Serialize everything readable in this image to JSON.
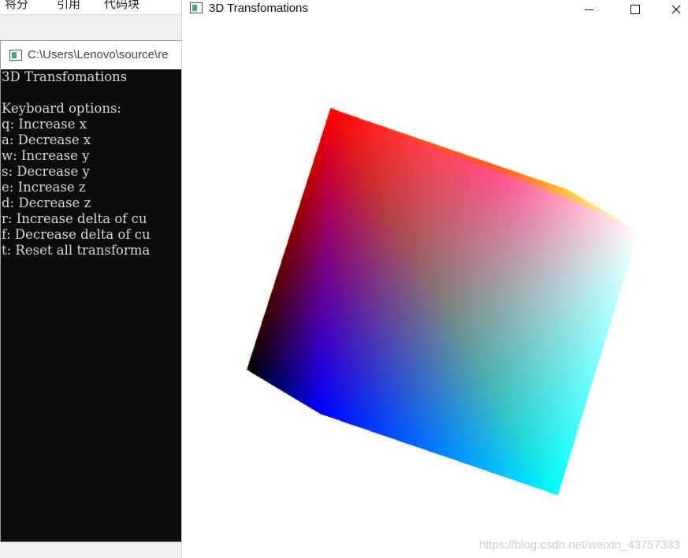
{
  "background_menu": {
    "items": [
      "将分",
      "引用",
      "代码块"
    ]
  },
  "console_window": {
    "title": "C:\\Users\\Lenovo\\source\\re",
    "lines": [
      "3D Transfomations",
      "",
      "Keyboard options:",
      "q: Increase x",
      "a: Decrease x",
      "w: Increase y",
      "s: Decrease y",
      "e: Increase z",
      "d: Decrease z",
      "r: Increase delta of cu",
      "f: Decrease delta of cu",
      "t: Reset all transforma"
    ]
  },
  "gl_window": {
    "title": "3D Transfomations",
    "buttons": {
      "minimize": "minimize-icon",
      "maximize": "maximize-icon",
      "close": "close-icon"
    },
    "cube_colors": {
      "red": "#ff0000",
      "magenta": "#ff00ff",
      "yellow": "#ffff00",
      "white": "#ffffff",
      "black": "#000000",
      "blue": "#0000ff",
      "cyan": "#00ffff"
    }
  },
  "watermark": "https://blog.csdn.net/weixin_43757333"
}
